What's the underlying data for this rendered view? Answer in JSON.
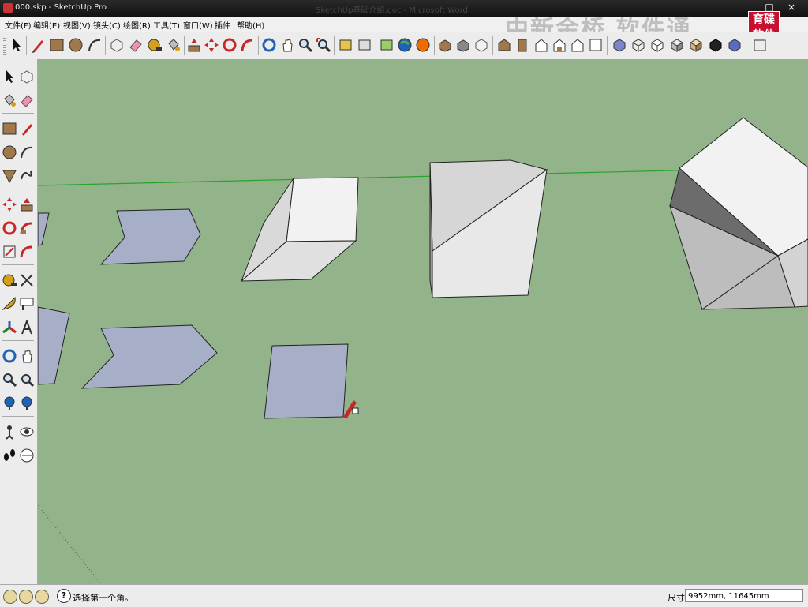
{
  "window": {
    "title": "000.skp - SketchUp Pro",
    "background_title": "SketchUp基础介绍.doc - Microsoft Word",
    "controls": [
      "□",
      "×"
    ]
  },
  "watermark": "中新金桥 软件通",
  "logo": {
    "line1": "育碟",
    "line2": "软件"
  },
  "menu": {
    "items": [
      "文件(F)",
      "编辑(E)",
      "视图(V)",
      "镜头(C)",
      "绘图(R)",
      "工具(T)",
      "窗口(W)",
      "插件",
      "帮助(H)"
    ]
  },
  "toolbar": {
    "icons": [
      "select-icon",
      "pencil-icon",
      "rectangle-icon",
      "circle-icon",
      "arc-icon",
      "make-component-icon",
      "eraser-icon",
      "tape-measure-icon",
      "paint-bucket-icon",
      "push-pull-icon",
      "move-icon",
      "rotate-icon",
      "follow-me-icon",
      "orbit-icon",
      "pan-icon",
      "zoom-icon",
      "zoom-extents-icon",
      "previous-view-icon",
      "next-view-icon",
      "add-location-icon",
      "google-earth-icon",
      "get-models-icon",
      "share-model-icon",
      "share-component-icon",
      "iso-view-icon",
      "top-view-icon",
      "front-view-icon",
      "right-view-icon",
      "back-view-icon",
      "left-view-icon",
      "xray-icon",
      "wireframe-icon",
      "hidden-line-icon",
      "shaded-icon",
      "shaded-texture-icon",
      "monochrome-icon",
      "section-icon"
    ]
  },
  "left_toolbar": {
    "icons": [
      "select-icon",
      "make-component-icon",
      "paint-bucket-icon",
      "eraser-icon",
      "rectangle-icon",
      "line-icon",
      "circle-icon",
      "arc-icon",
      "polygon-icon",
      "freehand-icon",
      "move-icon",
      "push-pull-icon",
      "rotate-icon",
      "follow-me-icon",
      "scale-icon",
      "offset-icon",
      "tape-measure-icon",
      "dimension-icon",
      "protractor-icon",
      "text-icon",
      "axes-icon",
      "3d-text-icon",
      "orbit-icon",
      "pan-icon",
      "zoom-icon",
      "zoom-window-icon",
      "zoom-extents-icon",
      "previous-view-icon",
      "position-camera-icon",
      "look-around-icon",
      "walk-icon",
      "section-plane-icon"
    ]
  },
  "colors": {
    "canvas": "#93b38a",
    "face_purple": "#a7aec7",
    "face_white": "#f2f2f2",
    "face_gray": "#bdbdbd",
    "face_dark": "#6c6c6c",
    "axis_green": "#2aa32a"
  },
  "status": {
    "message": "选择第一个角。",
    "measurement_label": "尺寸",
    "measurement_value": "9952mm, 11645mm",
    "help_icon": "?"
  }
}
